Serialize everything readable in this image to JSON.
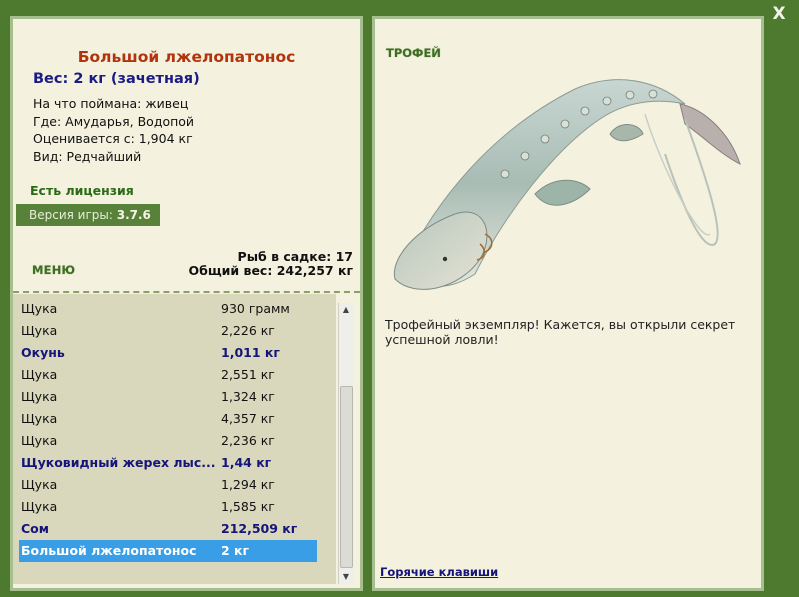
{
  "window": {
    "close_label": "X"
  },
  "fish": {
    "title": "Большой лжелопатонос",
    "weight_line": "Вес: 2 кг (зачетная)",
    "details": [
      "На что поймана: живец",
      "Где: Амударья, Водопой",
      "Оценивается с: 1,904 кг",
      "Вид: Редчайший"
    ]
  },
  "license": "Есть лицензия",
  "version": {
    "label": "Версия игры:",
    "value": "3.7.6"
  },
  "menu_label": "МЕНЮ",
  "stats": {
    "fish_count": "Рыб в садке: 17",
    "total_weight": "Общий вес: 242,257 кг"
  },
  "catch_list": [
    {
      "name": "Щука",
      "weight": "930 грамм",
      "rare": false,
      "selected": false
    },
    {
      "name": "Щука",
      "weight": "2,226 кг",
      "rare": false,
      "selected": false
    },
    {
      "name": "Окунь",
      "weight": "1,011 кг",
      "rare": true,
      "selected": false
    },
    {
      "name": "Щука",
      "weight": "2,551 кг",
      "rare": false,
      "selected": false
    },
    {
      "name": "Щука",
      "weight": "1,324 кг",
      "rare": false,
      "selected": false
    },
    {
      "name": "Щука",
      "weight": "4,357 кг",
      "rare": false,
      "selected": false
    },
    {
      "name": "Щука",
      "weight": "2,236 кг",
      "rare": false,
      "selected": false
    },
    {
      "name": "Щуковидный жерех лыс...",
      "weight": "1,44 кг",
      "rare": true,
      "selected": false
    },
    {
      "name": "Щука",
      "weight": "1,294 кг",
      "rare": false,
      "selected": false
    },
    {
      "name": "Щука",
      "weight": "1,585 кг",
      "rare": false,
      "selected": false
    },
    {
      "name": "Сом",
      "weight": "212,509 кг",
      "rare": true,
      "selected": false
    },
    {
      "name": "Большой лжелопатонос",
      "weight": "2 кг",
      "rare": false,
      "selected": true
    }
  ],
  "trophy": {
    "label": "ТРОФЕЙ",
    "text": "Трофейный экземпляр! Кажется, вы открыли секрет успешной ловли!"
  },
  "hotkeys_label": "Горячие клавиши",
  "colors": {
    "background": "#4d7a2e",
    "panel": "#f4f1df",
    "panel_border": "#a7bf8e",
    "title": "#b1340d",
    "rare_text": "#14147a",
    "selected_row": "#3a9ee6",
    "list_bg": "#d9d8bc"
  }
}
